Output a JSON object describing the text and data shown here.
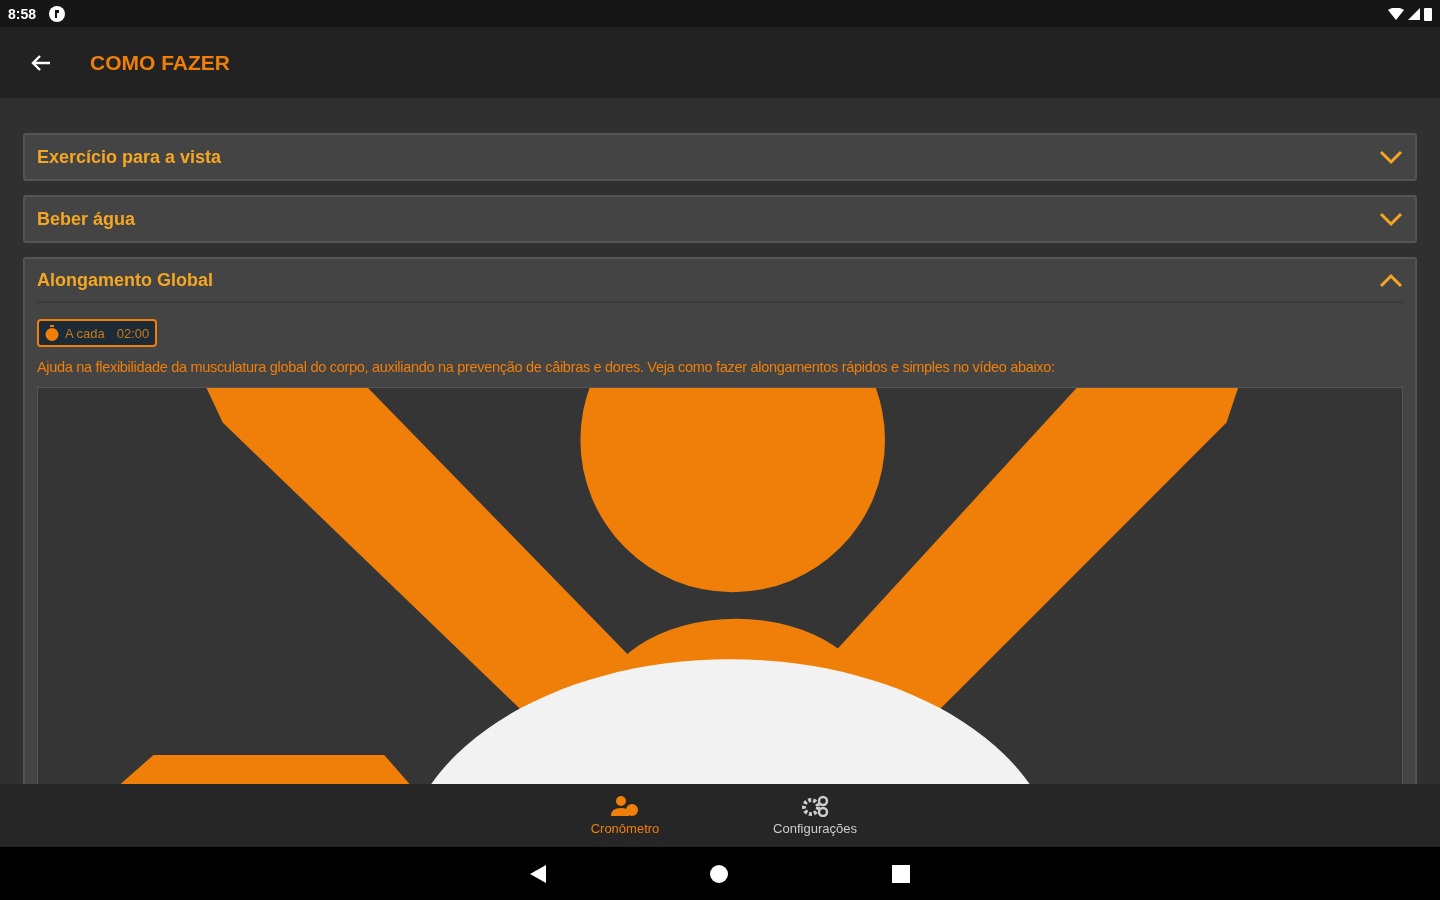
{
  "status_bar": {
    "time": "8:58"
  },
  "app_bar": {
    "title": "COMO FAZER"
  },
  "sections": [
    {
      "title": "Exercício para a vista",
      "expanded": false
    },
    {
      "title": "Beber água",
      "expanded": false
    },
    {
      "title": "Alongamento Global",
      "expanded": true,
      "interval": {
        "label": "A cada",
        "value": "02:00"
      },
      "description": "Ajuda na flexibilidade da musculatura global do corpo, auxiliando na prevenção de câibras e dores. Veja como fazer alongamentos rápidos e simples no vídeo abaixo:"
    }
  ],
  "bottom_nav": [
    {
      "label": "Cronômetro",
      "selected": true,
      "kind": "timer"
    },
    {
      "label": "Configurações",
      "selected": false,
      "kind": "settings"
    }
  ]
}
